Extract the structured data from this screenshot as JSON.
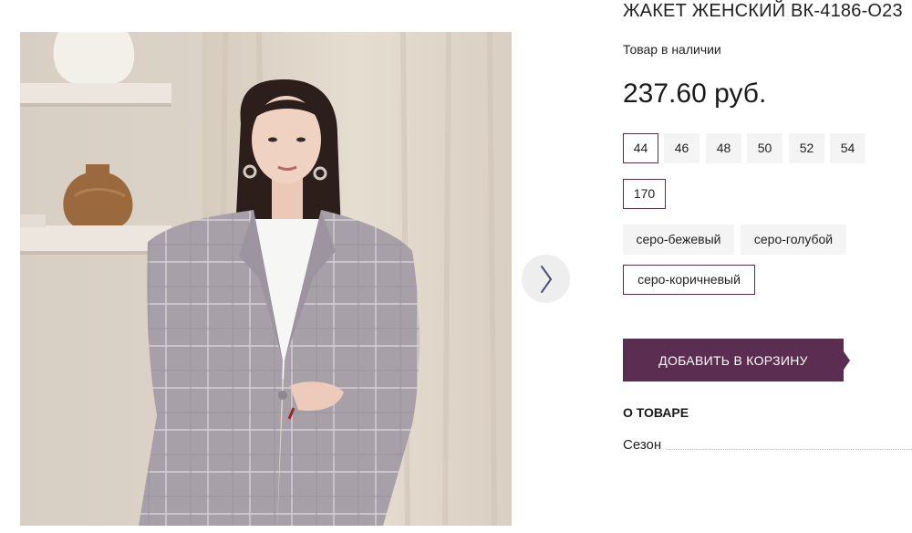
{
  "product": {
    "title": "ЖАКЕТ ЖЕНСКИЙ ВК-4186-О23",
    "stock_status": "Товар в наличии",
    "price": "237.60 руб."
  },
  "sizes": [
    {
      "label": "44",
      "selected": true
    },
    {
      "label": "46",
      "selected": false
    },
    {
      "label": "48",
      "selected": false
    },
    {
      "label": "50",
      "selected": false
    },
    {
      "label": "52",
      "selected": false
    },
    {
      "label": "54",
      "selected": false
    }
  ],
  "heights": [
    {
      "label": "170",
      "selected": true
    }
  ],
  "colors": [
    {
      "label": "серо-бежевый",
      "selected": false
    },
    {
      "label": "серо-голубой",
      "selected": false
    },
    {
      "label": "серо-коричневый",
      "selected": true
    }
  ],
  "cart": {
    "add_label": "ДОБАВИТЬ В КОРЗИНУ"
  },
  "details": {
    "heading": "О ТОВАРЕ",
    "season_label": "Сезон"
  },
  "gallery": {
    "next_icon": "chevron-right-icon"
  },
  "theme": {
    "accent": "#5b2d50",
    "chip_bg": "#f4f4f4"
  }
}
